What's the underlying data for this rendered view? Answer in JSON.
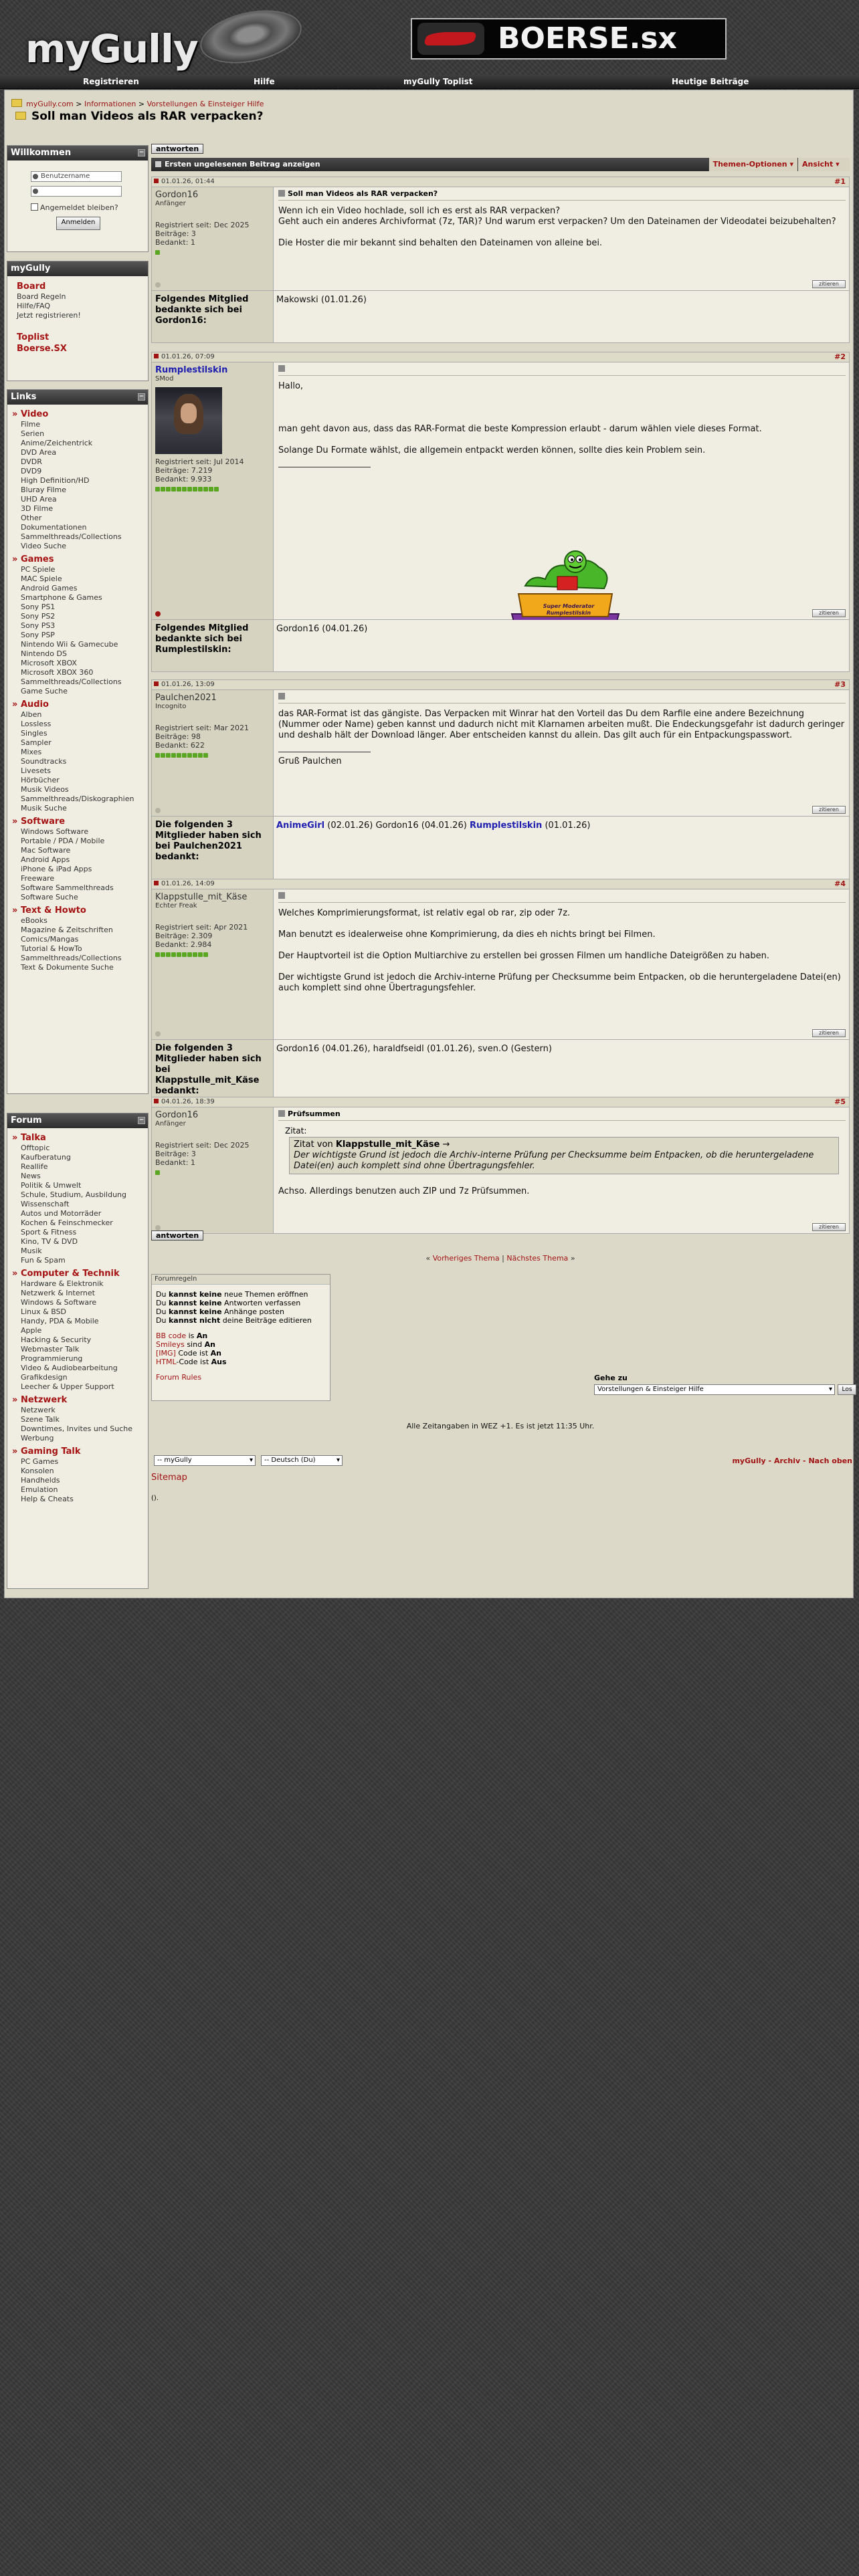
{
  "header": {
    "logo_text": "myGully",
    "banner_text": "BOERSE.sx"
  },
  "nav": [
    "Registrieren",
    "Hilfe",
    "myGully Toplist",
    "Heutige Beiträge"
  ],
  "breadcrumb": {
    "items": [
      "myGully.com",
      "Informationen",
      "Vorstellungen & Einsteiger Hilfe"
    ],
    "separator": ">"
  },
  "thread": {
    "title": "Soll man Videos als RAR verpacken?"
  },
  "buttons": {
    "reply": "antworten",
    "quote": "zitieren"
  },
  "toolbar": {
    "first_unread": "Ersten ungelesenen Beitrag anzeigen",
    "thread_options": "Themen-Optionen",
    "view": "Ansicht"
  },
  "sidebar": {
    "welcome": {
      "title": "Willkommen",
      "username_placeholder": "Benutzername",
      "remember": "Angemeldet bleiben?",
      "login": "Anmelden"
    },
    "mygully": {
      "title": "myGully",
      "items": [
        {
          "label": "Board",
          "style": "cat"
        },
        {
          "label": "Board Regeln",
          "style": "link"
        },
        {
          "label": "Hilfe/FAQ",
          "style": "link"
        },
        {
          "label": "Jetzt registrieren!",
          "style": "link"
        },
        {
          "label": "Toplist",
          "style": "cat"
        },
        {
          "label": "Boerse.SX",
          "style": "cat"
        }
      ]
    },
    "links": {
      "title": "Links",
      "groups": [
        {
          "name": "Video",
          "items": [
            "Filme",
            "Serien",
            "Anime/Zeichentrick",
            "DVD Area",
            "DVDR",
            "DVD9",
            "High Definition/HD",
            "Bluray Filme",
            "UHD Area",
            "3D Filme",
            "Other",
            "Dokumentationen",
            "Sammelthreads/Collections",
            "Video Suche"
          ]
        },
        {
          "name": "Games",
          "items": [
            "PC Spiele",
            "MAC Spiele",
            "Android Games",
            "Smartphone & Games",
            "Sony PS1",
            "Sony PS2",
            "Sony PS3",
            "Sony PSP",
            "Nintendo Wii & Gamecube",
            "Nintendo DS",
            "Microsoft XBOX",
            "Microsoft XBOX 360",
            "Sammelthreads/Collections",
            "Game Suche"
          ]
        },
        {
          "name": "Audio",
          "items": [
            "Alben",
            "Lossless",
            "Singles",
            "Sampler",
            "Mixes",
            "Soundtracks",
            "Livesets",
            "Hörbücher",
            "Musik Videos",
            "Sammelthreads/Diskographien",
            "Musik Suche"
          ]
        },
        {
          "name": "Software",
          "items": [
            "Windows Software",
            "Portable / PDA / Mobile",
            "Mac Software",
            "Android Apps",
            "iPhone & iPad Apps",
            "Freeware",
            "Software Sammelthreads",
            "Software Suche"
          ]
        },
        {
          "name": "Text & Howto",
          "items": [
            "eBooks",
            "Magazine & Zeitschriften",
            "Comics/Mangas",
            "Tutorial & HowTo",
            "Sammelthreads/Collections",
            "Text & Dokumente Suche"
          ]
        }
      ]
    },
    "forum": {
      "title": "Forum",
      "groups": [
        {
          "name": "Talka",
          "items": [
            "Offtopic",
            "Kaufberatung",
            "Reallife",
            "News",
            "Politik & Umwelt",
            "Schule, Studium, Ausbildung",
            "Wissenschaft",
            "Autos und Motorräder",
            "Kochen & Feinschmecker",
            "Sport & Fitness",
            "Kino, TV & DVD",
            "Musik",
            "Fun & Spam"
          ]
        },
        {
          "name": "Computer & Technik",
          "items": [
            "Hardware & Elektronik",
            "Netzwerk & Internet",
            "Windows & Software",
            "Linux & BSD",
            "Handy, PDA & Mobile",
            "Apple",
            "Hacking & Security",
            "Webmaster Talk",
            "Programmierung",
            "Video & Audiobearbeitung",
            "Grafikdesign",
            "Leecher & Upper Support"
          ]
        },
        {
          "name": "Netzwerk",
          "items": [
            "Netzwerk",
            "Szene Talk",
            "Downtimes, Invites und Suche",
            "Werbung"
          ]
        },
        {
          "name": "Gaming Talk",
          "items": [
            "PC Games",
            "Konsolen",
            "Handhelds",
            "Emulation",
            "Help & Cheats"
          ]
        }
      ]
    }
  },
  "posts": [
    {
      "date": "01.01.26, 01:44",
      "num": "#1",
      "user": "Gordon16",
      "rank": "Anfänger",
      "mod": false,
      "stats": [
        "Registriert seit: Dec 2025",
        "Beiträge: 3",
        "Bedankt: 1"
      ],
      "rep": 1,
      "online": false,
      "title": "Soll man Videos als RAR verpacken?",
      "paragraphs": [
        "Wenn ich ein Video hochlade, soll ich es erst als RAR verpacken?\nGeht auch ein anderes Archivformat (7z, TAR)? Und warum erst verpacken? Um den Dateinamen der Videodatei beizubehalten?",
        "Die Hoster die mir bekannt sind behalten den Dateinamen von alleine bei."
      ],
      "thanks_label": "Folgendes Mitglied bedankte sich bei Gordon16:",
      "thanks": [
        {
          "name": "Makowski",
          "date": "(01.01.26)",
          "mod": false
        }
      ]
    },
    {
      "date": "01.01.26, 07:09",
      "num": "#2",
      "user": "Rumplestilskin",
      "rank": "SMod",
      "mod": true,
      "stats": [
        "Registriert seit: Jul 2014",
        "Beiträge: 7.219",
        "Bedankt: 9.933"
      ],
      "rep": 12,
      "online": true,
      "title": "",
      "paragraphs": [
        "Hallo,",
        "",
        "man geht davon aus, dass das RAR-Format die beste Kompression erlaubt - darum wählen viele dieses Format.",
        "Solange Du Formate wählst, die allgemein entpackt werden können, sollte dies kein Problem sein."
      ],
      "signature": "Super Moderator Rumplestilskin",
      "thanks_label": "Folgendes Mitglied bedankte sich bei Rumplestilskin:",
      "thanks": [
        {
          "name": "Gordon16",
          "date": "(04.01.26)",
          "mod": false
        }
      ]
    },
    {
      "date": "01.01.26, 13:09",
      "num": "#3",
      "user": "Paulchen2021",
      "rank": "Incognito",
      "mod": false,
      "stats": [
        "Registriert seit: Mar 2021",
        "Beiträge: 98",
        "Bedankt: 622"
      ],
      "rep": 10,
      "online": false,
      "title": "",
      "paragraphs": [
        "das RAR-Format ist das gängiste. Das Verpacken mit Winrar hat den Vorteil das Du dem Rarfile eine andere Bezeichnung (Nummer oder Name) geben kannst und dadurch nicht mit Klarnamen arbeiten mußt. Die Endeckungsgefahr ist dadurch geringer und deshalb hält der Download länger. Aber entscheiden kannst du allein. Das gilt auch für ein Entpackungspasswort."
      ],
      "sig_text": "Gruß Paulchen",
      "thanks_label": "Die folgenden 3 Mitglieder haben sich bei Paulchen2021 bedankt:",
      "thanks": [
        {
          "name": "AnimeGirl",
          "date": "(02.01.26)",
          "mod": true
        },
        {
          "name": "Gordon16",
          "date": "(04.01.26)",
          "mod": false
        },
        {
          "name": "Rumplestilskin",
          "date": "(01.01.26)",
          "mod": true
        }
      ]
    },
    {
      "date": "01.01.26, 14:09",
      "num": "#4",
      "user": "Klappstulle_mit_Käse",
      "rank": "Echter Freak",
      "mod": false,
      "stats": [
        "Registriert seit: Apr 2021",
        "Beiträge: 2.309",
        "Bedankt: 2.984"
      ],
      "rep": 10,
      "online": false,
      "title": "",
      "paragraphs": [
        "Welches Komprimierungsformat, ist relativ egal ob rar, zip oder 7z.",
        "Man benutzt es idealerweise ohne Komprimierung, da dies eh nichts bringt bei Filmen.",
        "Der Hauptvorteil ist die Option Multiarchive zu erstellen bei grossen Filmen um handliche Dateigrößen zu haben.",
        "Der wichtigste Grund ist jedoch die Archiv-interne Prüfung per Checksumme beim Entpacken, ob die heruntergeladene Datei(en) auch komplett sind ohne Übertragungsfehler."
      ],
      "thanks_label": "Die folgenden 3 Mitglieder haben sich bei Klappstulle_mit_Käse bedankt:",
      "thanks": [
        {
          "name": "Gordon16",
          "date": "(04.01.26),",
          "mod": false
        },
        {
          "name": "haraldfseidl",
          "date": "(01.01.26),",
          "mod": false
        },
        {
          "name": "sven.O",
          "date": "(Gestern)",
          "mod": false
        }
      ]
    },
    {
      "date": "04.01.26, 18:39",
      "num": "#5",
      "user": "Gordon16",
      "rank": "Anfänger",
      "mod": false,
      "stats": [
        "Registriert seit: Dec 2025",
        "Beiträge: 3",
        "Bedankt: 1"
      ],
      "rep": 1,
      "online": false,
      "title": "Prüfsummen",
      "quote_label": "Zitat:",
      "quote_from_prefix": "Zitat von",
      "quote_from": "Klappstulle_mit_Käse",
      "quote_arrow": "→",
      "quote_text": "Der wichtigste Grund ist jedoch die Archiv-interne Prüfung per Checksumme beim Entpacken, ob die heruntergeladene Datei(en) auch komplett sind ohne Übertragungsfehler.",
      "paragraphs": [
        "Achso. Allerdings benutzen auch ZIP und 7z Prüfsummen."
      ]
    }
  ],
  "thread_nav": {
    "prev": "Vorheriges Thema",
    "sep": "|",
    "next": "Nächstes Thema",
    "left": "«",
    "right": "»"
  },
  "forum_rules": {
    "title": "Forumregeln",
    "lines": [
      [
        "Du ",
        "kannst keine",
        " neue Themen eröffnen"
      ],
      [
        "Du ",
        "kannst keine",
        " Antworten verfassen"
      ],
      [
        "Du ",
        "kannst keine",
        " Anhänge posten"
      ],
      [
        "Du ",
        "kannst nicht",
        " deine Beiträge editieren"
      ]
    ],
    "codes": [
      [
        "BB code",
        " is ",
        "An"
      ],
      [
        "Smileys",
        " sind ",
        "An"
      ],
      [
        "[IMG]",
        " Code ist ",
        "An"
      ],
      [
        "HTML",
        "-Code ist ",
        "Aus"
      ]
    ],
    "link": "Forum Rules"
  },
  "goto": {
    "label": "Gehe zu",
    "selected": "Vorstellungen & Einsteiger Hilfe",
    "button": "Los"
  },
  "timezone": "Alle Zeitangaben in WEZ +1. Es ist jetzt 11:35 Uhr.",
  "footer": {
    "style_select": "-- myGully",
    "lang_select": "-- Deutsch (Du)",
    "links": [
      "myGully",
      "Archiv",
      "Nach oben"
    ],
    "link_sep": "-",
    "sitemap": "Sitemap",
    "copyright": "()."
  },
  "colors": {
    "accent": "#a11313",
    "panel": "#dcd9c8",
    "post_bg": "#f0eee3",
    "mod_name": "#2020b0"
  }
}
